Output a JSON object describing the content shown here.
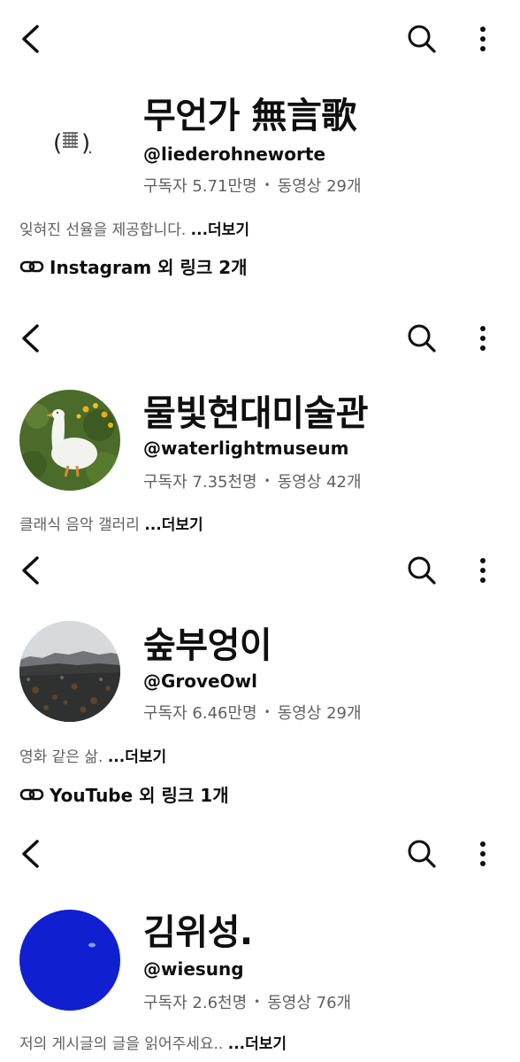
{
  "icons": {
    "back": "back-arrow-icon",
    "search": "search-icon",
    "more": "more-vert-icon",
    "link": "link-icon"
  },
  "channels": [
    {
      "name": "무언가 無言歌",
      "handle": "@liederohneworte",
      "subscribers": "구독자 5.71만명",
      "videos": "동영상 29개",
      "description": "잊혀진 선율을 제공합니다.",
      "more_label": "...더보기",
      "links_label": "Instagram 외 링크 2개"
    },
    {
      "name": "물빛현대미술관",
      "handle": "@waterlightmuseum",
      "subscribers": "구독자 7.35천명",
      "videos": "동영상 42개",
      "description": "클래식 음악 갤러리",
      "more_label": "...더보기"
    },
    {
      "name": "숲부엉이",
      "handle": "@GroveOwl",
      "subscribers": "구독자 6.46만명",
      "videos": "동영상 29개",
      "description": "영화 같은 삶.",
      "more_label": "...더보기",
      "links_label": "YouTube 외 링크 1개"
    },
    {
      "name": "김위성.",
      "handle": "@wiesung",
      "subscribers": "구독자 2.6천명",
      "videos": "동영상 76개",
      "description": "저의 게시글의 글을 읽어주세요..",
      "more_label": "...더보기"
    }
  ],
  "colors": {
    "text": "#0f0f0f",
    "secondary": "#606060",
    "avatar_blue": "#1020d0"
  }
}
